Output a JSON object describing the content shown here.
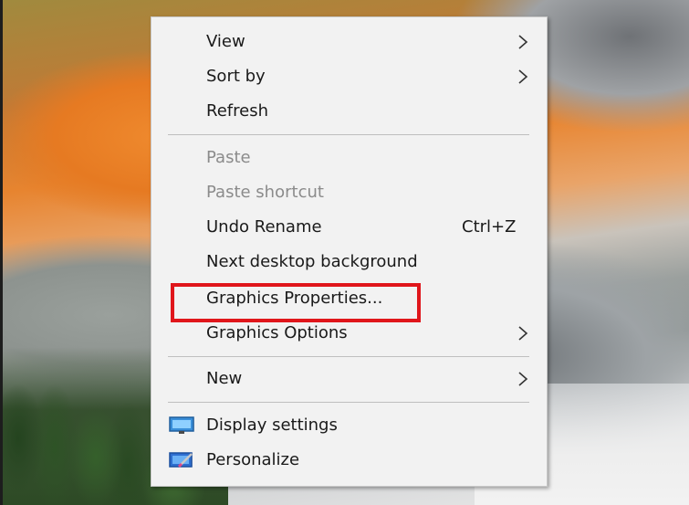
{
  "context_menu": {
    "items": [
      {
        "label": "View",
        "submenu": true
      },
      {
        "label": "Sort by",
        "submenu": true
      },
      {
        "label": "Refresh"
      },
      {
        "label": "Paste",
        "disabled": true
      },
      {
        "label": "Paste shortcut",
        "disabled": true
      },
      {
        "label": "Undo Rename",
        "shortcut": "Ctrl+Z"
      },
      {
        "label": "Next desktop background"
      },
      {
        "label": "Graphics Properties..."
      },
      {
        "label": "Graphics Options",
        "submenu": true
      },
      {
        "label": "New",
        "submenu": true
      },
      {
        "label": "Display settings",
        "icon": "display-settings-icon"
      },
      {
        "label": "Personalize",
        "icon": "personalize-icon"
      }
    ]
  },
  "annotation": {
    "highlight_color": "#e0161b",
    "highlighted_item": "Graphics Properties..."
  },
  "colors": {
    "menu_bg": "#f2f2f2",
    "text": "#1a1a1a",
    "disabled_text": "#8b8b8b",
    "separator": "#bfbfbf"
  }
}
